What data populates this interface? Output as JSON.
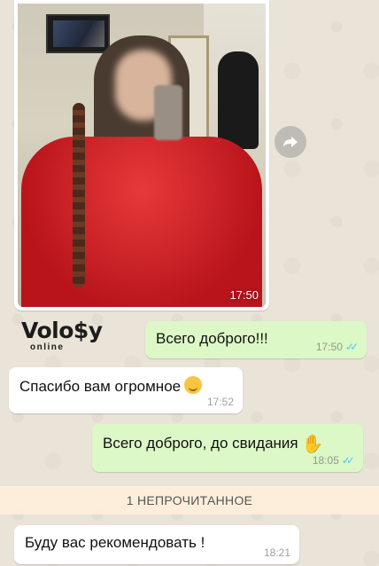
{
  "photo_message": {
    "time": "17:50",
    "forward_icon": "forward-arrow-icon"
  },
  "logo": {
    "word": "Volo$y",
    "subtitle": "online"
  },
  "messages": [
    {
      "direction": "outgoing",
      "text": "Всего доброго!!!",
      "time": "17:50",
      "status": "read"
    },
    {
      "direction": "incoming",
      "text": "Спасибо вам огромное",
      "emoji": "relieved-face",
      "time": "17:52"
    },
    {
      "direction": "outgoing",
      "text": "Всего доброго, до свидания",
      "emoji": "waving-hand",
      "time": "18:05",
      "status": "read"
    },
    {
      "direction": "incoming",
      "text": "Буду вас рекомендовать !",
      "time": "18:21"
    }
  ],
  "unread_divider": "1 НЕПРОЧИТАННОЕ",
  "colors": {
    "outgoing_bubble": "#dcf8c6",
    "incoming_bubble": "#ffffff",
    "read_ticks": "#4fc3f7",
    "chat_background": "#e9e3d8"
  }
}
